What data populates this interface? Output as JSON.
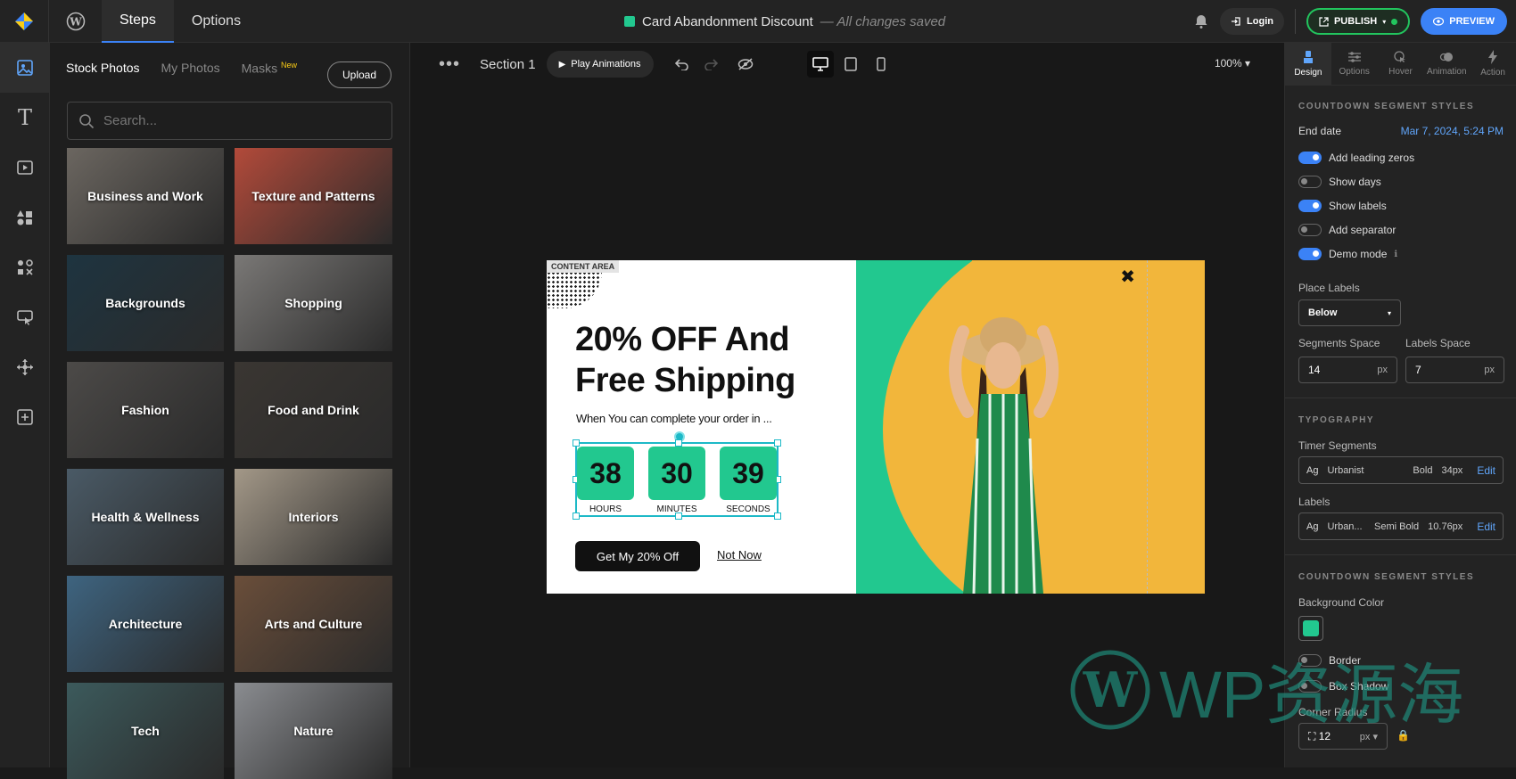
{
  "topbar": {
    "nav_tabs": [
      "Steps",
      "Options"
    ],
    "campaign_title": "Card Abandonment Discount",
    "save_status": "— All changes saved",
    "login_label": "Login",
    "publish_label": "PUBLISH",
    "preview_label": "PREVIEW"
  },
  "photos_panel": {
    "tabs": [
      {
        "label": "Stock Photos"
      },
      {
        "label": "My Photos"
      },
      {
        "label": "Masks",
        "badge": "New"
      }
    ],
    "upload_label": "Upload",
    "search_placeholder": "Search...",
    "categories": [
      {
        "label": "Business and Work",
        "color": "#6b6660"
      },
      {
        "label": "Texture and Patterns",
        "color": "#b24a3a"
      },
      {
        "label": "Backgrounds",
        "color": "#1e3440"
      },
      {
        "label": "Shopping",
        "color": "#7a7876"
      },
      {
        "label": "Fashion",
        "color": "#4c4a48"
      },
      {
        "label": "Food and Drink",
        "color": "#3a3632"
      },
      {
        "label": "Health & Wellness",
        "color": "#4a5a66"
      },
      {
        "label": "Interiors",
        "color": "#a39888"
      },
      {
        "label": "Architecture",
        "color": "#3e6480"
      },
      {
        "label": "Arts and Culture",
        "color": "#6a4e3a"
      },
      {
        "label": "Tech",
        "color": "#3c5a5c"
      },
      {
        "label": "Nature",
        "color": "#8a8c90"
      }
    ]
  },
  "canvas": {
    "section_label": "Section 1",
    "play_label": "Play Animations",
    "zoom": "100%",
    "popup": {
      "content_area_label": "CONTENT AREA",
      "headline": "20% OFF And Free Shipping",
      "subtext": "When You can complete your order in ...",
      "segments": [
        {
          "value": "38",
          "label": "HOURS"
        },
        {
          "value": "30",
          "label": "MINUTES"
        },
        {
          "value": "39",
          "label": "SECONDS"
        }
      ],
      "cta_label": "Get My  20% Off",
      "dismiss_label": "Not Now",
      "close_symbol": "✖"
    }
  },
  "right_panel": {
    "tabs": [
      "Design",
      "Options",
      "Hover",
      "Animation",
      "Action"
    ],
    "countdown_header": "COUNTDOWN SEGMENT STYLES",
    "end_date_label": "End date",
    "end_date_value": "Mar 7, 2024, 5:24 PM",
    "toggles": [
      {
        "label": "Add leading zeros",
        "on": true
      },
      {
        "label": "Show days",
        "on": false
      },
      {
        "label": "Show labels",
        "on": true
      },
      {
        "label": "Add separator",
        "on": false
      },
      {
        "label": "Demo mode",
        "on": true
      }
    ],
    "place_labels_label": "Place Labels",
    "place_labels_value": "Below",
    "segments_space_label": "Segments Space",
    "segments_space_value": "14",
    "labels_space_label": "Labels Space",
    "labels_space_value": "7",
    "unit": "px",
    "typography_header": "TYPOGRAPHY",
    "timer_segments_label": "Timer Segments",
    "timer_font": {
      "ag": "Ag",
      "family": "Urbanist",
      "weight": "Bold",
      "size": "34px",
      "edit": "Edit"
    },
    "labels_label": "Labels",
    "labels_font": {
      "ag": "Ag",
      "family": "Urban...",
      "weight": "Semi Bold",
      "size": "10.76px",
      "edit": "Edit"
    },
    "segment_styles_header": "COUNTDOWN SEGMENT STYLES",
    "background_color_label": "Background Color",
    "background_color": "#22c88f",
    "border_label": "Border",
    "box_shadow_label": "Box Shadow",
    "corner_radius_label": "Corner Radius",
    "corner_radius_value": "12",
    "corner_unit": "px"
  },
  "watermark": "WP资源海"
}
